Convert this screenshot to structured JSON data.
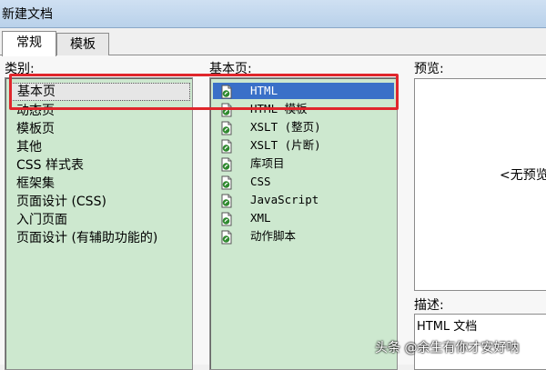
{
  "window": {
    "title": "新建文档"
  },
  "tabs": [
    {
      "label": "常规"
    },
    {
      "label": "模板"
    }
  ],
  "category": {
    "label": "类别:",
    "items": [
      "基本页",
      "动态页",
      "模板页",
      "其他",
      "CSS 样式表",
      "框架集",
      "页面设计 (CSS)",
      "入门页面",
      "页面设计 (有辅助功能的)"
    ]
  },
  "basic_page": {
    "label": "基本页:",
    "items": [
      {
        "label": "HTML",
        "icon": "dreamweaver-file-icon"
      },
      {
        "label": "HTML 模板",
        "icon": "dreamweaver-file-icon"
      },
      {
        "label": "XSLT (整页)",
        "icon": "dreamweaver-file-icon"
      },
      {
        "label": "XSLT (片断)",
        "icon": "dreamweaver-file-icon"
      },
      {
        "label": "库项目",
        "icon": "dreamweaver-file-icon"
      },
      {
        "label": "CSS",
        "icon": "dreamweaver-file-icon"
      },
      {
        "label": "JavaScript",
        "icon": "dreamweaver-file-icon"
      },
      {
        "label": "XML",
        "icon": "dreamweaver-file-icon"
      },
      {
        "label": "动作脚本",
        "icon": "dreamweaver-file-icon"
      }
    ]
  },
  "preview": {
    "label": "预览:",
    "text": "<无预览"
  },
  "description": {
    "label": "描述:",
    "text": "HTML 文档"
  },
  "watermark": "头条 @余生有你才安好呐",
  "colors": {
    "list_bg": "#cde8cf",
    "selection": "#3a70c8",
    "highlight": "#e0262c"
  }
}
